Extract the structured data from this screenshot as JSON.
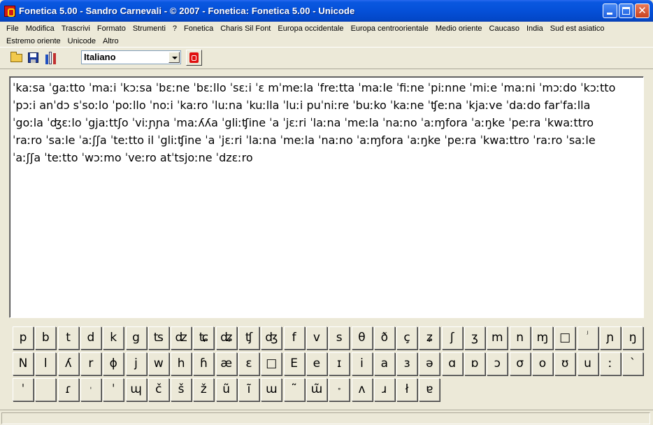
{
  "window": {
    "title": "Fonetica 5.00 - Sandro Carnevali - ©  2007 - Fonetica: Fonetica 5.00 - Unicode"
  },
  "menu": {
    "row1": [
      "File",
      "Modifica",
      "Trascrivi",
      "Formato",
      "Strumenti",
      "?",
      "Fonetica",
      "Charis Sil Font",
      "Europa occidentale",
      "Europa centroorientale",
      "Medio oriente",
      "Caucaso",
      "India",
      "Sud est asiatico"
    ],
    "row2": [
      "Estremo oriente",
      "Unicode",
      "Altro"
    ]
  },
  "toolbar": {
    "open_icon": "folder-open-icon",
    "save_icon": "floppy-disk-icon",
    "books_icon": "books-icon",
    "language_value": "Italiano",
    "alphabet_icon": "red-alphabet-icon"
  },
  "editor": {
    "lines": [
      "ˈkaːsa ˈgaːtto ˈmaːi ˈkɔːsa ˈbɛːne ˈbɛːllo ˈsɛːi ˈɛ mˈmeːla ˈfreːtta ˈmaːle ˈfiːne ˈpiːnne ˈmiːe ˈmaːni ˈmɔːdo ˈkɔːtto",
      "ˈpɔːi anˈdɔ sˈsoːlo ˈpoːllo ˈnoːi ˈkaːro ˈluːna ˈkuːlla ˈluːi puˈniːre ˈbuːko ˈkaːne ˈʧeːna ˈkjaːve ˈdaːdo farˈfaːlla",
      "ˈgoːla ˈʤɛːlo ˈgjaːttʃo ˈviːɲɲa ˈmaːʎʎa ˈgliːʧine ˈa ˈjɛːri ˈlaːna ˈmeːla ˈnaːno ˈaːɱfora ˈaːŋke ˈpeːra ˈkwaːttro",
      "ˈraːro ˈsaːle ˈaːʃʃa ˈteːtto il ˈgliːʧine ˈa ˈjɛːri ˈlaːna ˈmeːla ˈnaːno ˈaːɱfora ˈaːŋke ˈpeːra ˈkwaːttro ˈraːro ˈsaːle",
      "ˈaːʃʃa ˈteːtto ˈwɔːmo ˈveːro atˈtsjoːne ˈdzɛːro"
    ]
  },
  "keyboard": {
    "row1": [
      "p",
      "b",
      "t",
      "d",
      "k",
      "g",
      "ʦ",
      "ʣ",
      "ʨ",
      "ʥ",
      "ʧ",
      "ʤ",
      "f",
      "v",
      "s",
      "θ",
      "ð",
      "ç",
      "ʑ",
      "ʃ",
      "ʒ",
      "m",
      "n",
      "ɱ",
      "□",
      "ʲ",
      "ɲ",
      "ŋ"
    ],
    "row2": [
      "N",
      "l",
      "ʎ",
      "r",
      "ɸ",
      "j",
      "w",
      "h",
      "ɦ",
      "æ",
      "ɛ",
      "□",
      "E",
      "e",
      "ɪ",
      "i",
      "a",
      "ɜ",
      "ə",
      "ɑ",
      "ɒ",
      "ɔ",
      "σ",
      "o",
      "ʊ",
      "u",
      "ː",
      "ˋ"
    ],
    "row3": [
      "ˈ",
      "",
      "ɾ",
      "ˌ",
      "ˈ",
      "ɰ",
      "č",
      "š",
      "ž",
      "ũ",
      "ĩ",
      "ɯ",
      "˜",
      "ɯ̃",
      "˳",
      "ʌ",
      "ɹ",
      "ł",
      "ɐ"
    ]
  }
}
